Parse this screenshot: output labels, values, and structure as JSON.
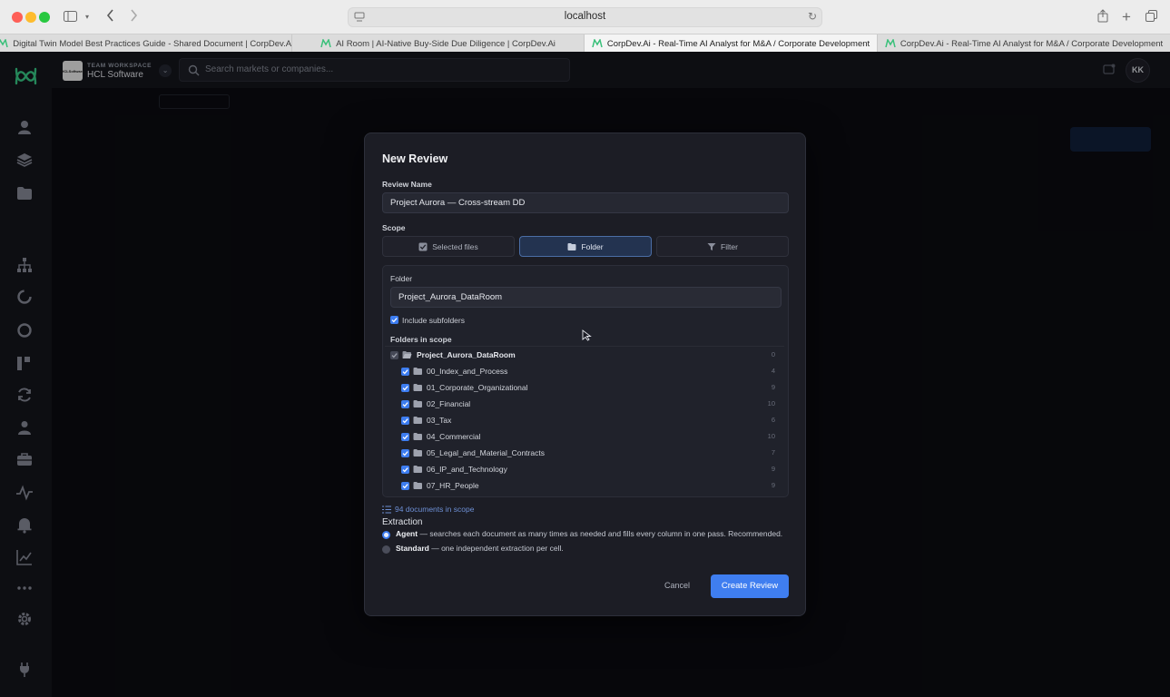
{
  "browser": {
    "url": "localhost",
    "tabs": [
      {
        "label": "Digital Twin Model Best Practices Guide - Shared Document | CorpDev.AI",
        "active": false
      },
      {
        "label": "AI Room | AI-Native Buy-Side Due Diligence | CorpDev.Ai",
        "active": false
      },
      {
        "label": "CorpDev.Ai - Real-Time AI Analyst for M&A / Corporate Development",
        "active": true
      },
      {
        "label": "CorpDev.Ai - Real-Time AI Analyst for M&A / Corporate Development",
        "active": false
      }
    ]
  },
  "topbar": {
    "workspace_eyebrow": "TEAM WORKSPACE",
    "workspace_name": "HCL Software",
    "workspace_logo_text": "HCLSoftware",
    "search_placeholder": "Search markets or companies...",
    "avatar_initials": "KK"
  },
  "sidebar": {
    "icons": [
      "user-icon",
      "layers-icon",
      "folder-icon",
      "org-chart-icon",
      "spinner-icon",
      "circle-icon",
      "kanban-icon",
      "refresh-icon",
      "person-icon",
      "briefcase-icon",
      "activity-icon",
      "bell-icon",
      "chart-icon",
      "more-icon",
      "settings-icon",
      "plug-icon"
    ]
  },
  "modal": {
    "title": "New Review",
    "review_name_label": "Review Name",
    "review_name_value": "Project Aurora — Cross-stream DD",
    "scope_label": "Scope",
    "scope_options": [
      {
        "label": "Selected files",
        "active": false
      },
      {
        "label": "Folder",
        "active": true
      },
      {
        "label": "Filter",
        "active": false
      }
    ],
    "folder_label": "Folder",
    "folder_value": "Project_Aurora_DataRoom",
    "include_subfolders_label": "Include subfolders",
    "include_subfolders_checked": true,
    "folders_in_scope_label": "Folders in scope",
    "folders": [
      {
        "name": "Project_Aurora_DataRoom",
        "count": "0",
        "root": true
      },
      {
        "name": "00_Index_and_Process",
        "count": "4"
      },
      {
        "name": "01_Corporate_Organizational",
        "count": "9"
      },
      {
        "name": "02_Financial",
        "count": "10"
      },
      {
        "name": "03_Tax",
        "count": "6"
      },
      {
        "name": "04_Commercial",
        "count": "10"
      },
      {
        "name": "05_Legal_and_Material_Contracts",
        "count": "7"
      },
      {
        "name": "06_IP_and_Technology",
        "count": "9"
      },
      {
        "name": "07_HR_People",
        "count": "9"
      }
    ],
    "documents_in_scope": "94 documents in scope",
    "extraction_label": "Extraction",
    "extraction_options": [
      {
        "name": "Agent",
        "desc": " — searches each document as many times as needed and fills every column in one pass. Recommended.",
        "selected": true
      },
      {
        "name": "Standard",
        "desc": " — one independent extraction per cell.",
        "selected": false
      }
    ],
    "cancel_label": "Cancel",
    "create_label": "Create Review"
  },
  "colors": {
    "accent": "#3f7ef0",
    "modal_bg": "#1c1d25",
    "app_bg": "#0b0c11",
    "sidebar_bg": "#15161d"
  }
}
